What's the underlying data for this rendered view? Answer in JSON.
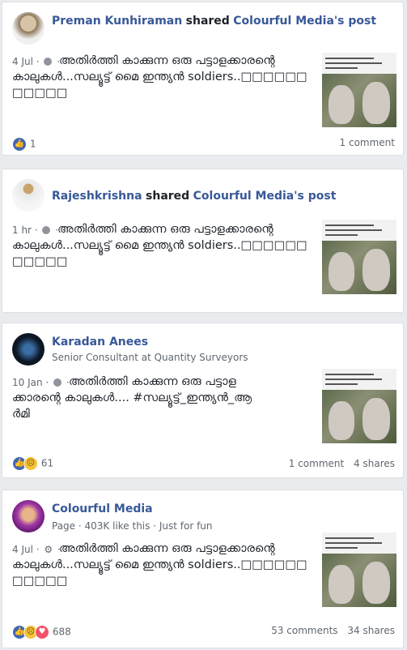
{
  "posts": [
    {
      "author": "Preman Kunhiraman",
      "shared_text": "shared",
      "shared_source": "Colourful Media's post",
      "time": "4 Jul",
      "text": "അതിർത്തി കാക്കുന്ന ഒരു പട്ടാളക്കാരന്റെ കാലുകൾ...സല്യൂട്ട് മൈ ഇന്ത്യൻ soldiers..□□□□□□□□□□□",
      "reaction_count": "1",
      "comments": "1 comment",
      "shares": ""
    },
    {
      "author": "Rajeshkrishna",
      "shared_text": "shared",
      "shared_source": "Colourful Media's post",
      "time": "1 hr",
      "text": "അതിർത്തി കാക്കുന്ന ഒരു പട്ടാളക്കാരന്റെ കാലുകൾ...സല്യൂട്ട് മൈ ഇന്ത്യൻ soldiers..□□□□□□□□□□□",
      "reaction_count": "",
      "comments": "",
      "shares": ""
    },
    {
      "author": "Karadan Anees",
      "subtitle": "Senior Consultant at Quantity Surveyors",
      "time": "10 Jan",
      "text": "അതിർത്തി കാക്കുന്ന ഒരു പട്ടാളക്കാരന്റെ കാലുകൾ.... #സല്യൂട്ട്_ഇന്ത്യൻ_ആർമി",
      "reaction_count": "61",
      "comments": "1 comment",
      "shares": "4 shares"
    },
    {
      "author": "Colourful Media",
      "page_label": "Page",
      "likes": "403K like this",
      "category": "Just for fun",
      "time": "4 Jul",
      "text": "അതിർത്തി കാക്കുന്ന ഒരു പട്ടാളക്കാരന്റെ കാലുകൾ...സല്യൂട്ട് മൈ ഇന്ത്യൻ soldiers..□□□□□□□□□□□",
      "reaction_count": "688",
      "comments": "53 comments",
      "shares": "34 shares"
    }
  ],
  "icons": {
    "globe": "globe-icon",
    "gear": "gear-icon",
    "like": "like-icon",
    "sad": "sad-icon",
    "love": "love-icon"
  },
  "colors": {
    "link": "#385898",
    "background": "#e9ebee",
    "like": "#4267b2"
  }
}
